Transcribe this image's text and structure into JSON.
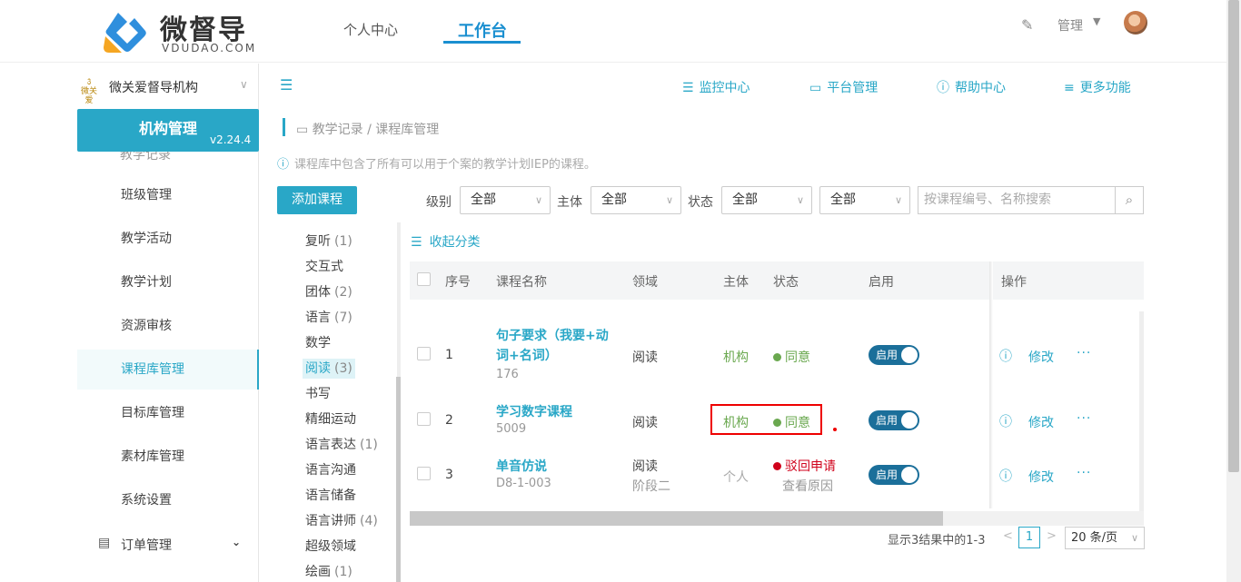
{
  "header": {
    "logo_cn": "微督导",
    "logo_en": "VDUDAO.COM",
    "nav": [
      "个人中心",
      "工作台"
    ],
    "user_label": "管理"
  },
  "sidebar": {
    "org_logo_text": "微关爱",
    "org_name": "微关爱督导机构",
    "panel_title": "机构管理",
    "version": "v2.24.4",
    "ghost_item": "教学记录",
    "items": [
      "班级管理",
      "教学活动",
      "教学计划",
      "资源审核",
      "课程库管理",
      "目标库管理",
      "素材库管理",
      "系统设置"
    ],
    "order_label": "订单管理"
  },
  "toolbar": {
    "links": [
      "监控中心",
      "平台管理",
      "帮助中心",
      "更多功能"
    ]
  },
  "breadcrumb": "教学记录 / 课程库管理",
  "info_text": "课程库中包含了所有可以用于个案的教学计划IEP的课程。",
  "filters": {
    "add_button": "添加课程",
    "level_label": "级别",
    "level_value": "全部",
    "subject_label": "主体",
    "subject_value": "全部",
    "status_label": "状态",
    "status_value": "全部",
    "extra_value": "全部",
    "search_placeholder": "按课程编号、名称搜索"
  },
  "categories": [
    {
      "name": "复听",
      "count": "(1)"
    },
    {
      "name": "交互式",
      "count": ""
    },
    {
      "name": "团体",
      "count": "(2)"
    },
    {
      "name": "语言",
      "count": "(7)"
    },
    {
      "name": "数学",
      "count": ""
    },
    {
      "name": "阅读",
      "count": "(3)"
    },
    {
      "name": "书写",
      "count": ""
    },
    {
      "name": "精细运动",
      "count": ""
    },
    {
      "name": "语言表达",
      "count": "(1)"
    },
    {
      "name": "语言沟通",
      "count": ""
    },
    {
      "name": "语言储备",
      "count": ""
    },
    {
      "name": "语言讲师",
      "count": "(4)"
    },
    {
      "name": "超级领域",
      "count": ""
    },
    {
      "name": "绘画",
      "count": "(1)"
    }
  ],
  "table": {
    "fold_label": "收起分类",
    "columns": [
      "序号",
      "课程名称",
      "领域",
      "主体",
      "状态",
      "启用",
      "操作"
    ],
    "rows": [
      {
        "no": "1",
        "name_l1": "句子要求（我要+动",
        "name_l2": "词+名词）",
        "code": "176",
        "domain": "阅读",
        "domain2": "",
        "subject": "机构",
        "status": "同意",
        "status_sub": "",
        "toggle": "启用",
        "edit": "修改",
        "more": "···"
      },
      {
        "no": "2",
        "name_l1": "学习数字课程",
        "name_l2": "",
        "code": "5009",
        "domain": "阅读",
        "domain2": "",
        "subject": "机构",
        "status": "同意",
        "status_sub": "",
        "toggle": "启用",
        "edit": "修改",
        "more": "···"
      },
      {
        "no": "3",
        "name_l1": "单音仿说",
        "name_l2": "",
        "code": "D8-1-003",
        "domain": "阅读",
        "domain2": "阶段二",
        "subject": "个人",
        "status": "驳回申请",
        "status_sub": "查看原因",
        "toggle": "启用",
        "edit": "修改",
        "more": "···"
      }
    ]
  },
  "pagination": {
    "summary": "显示3结果中的1-3",
    "page": "1",
    "page_size": "20 条/页"
  },
  "colors": {
    "accent": "#29a7c7",
    "ok": "#6aa84f",
    "reject": "#d0021b",
    "highlight": "#e00000"
  }
}
